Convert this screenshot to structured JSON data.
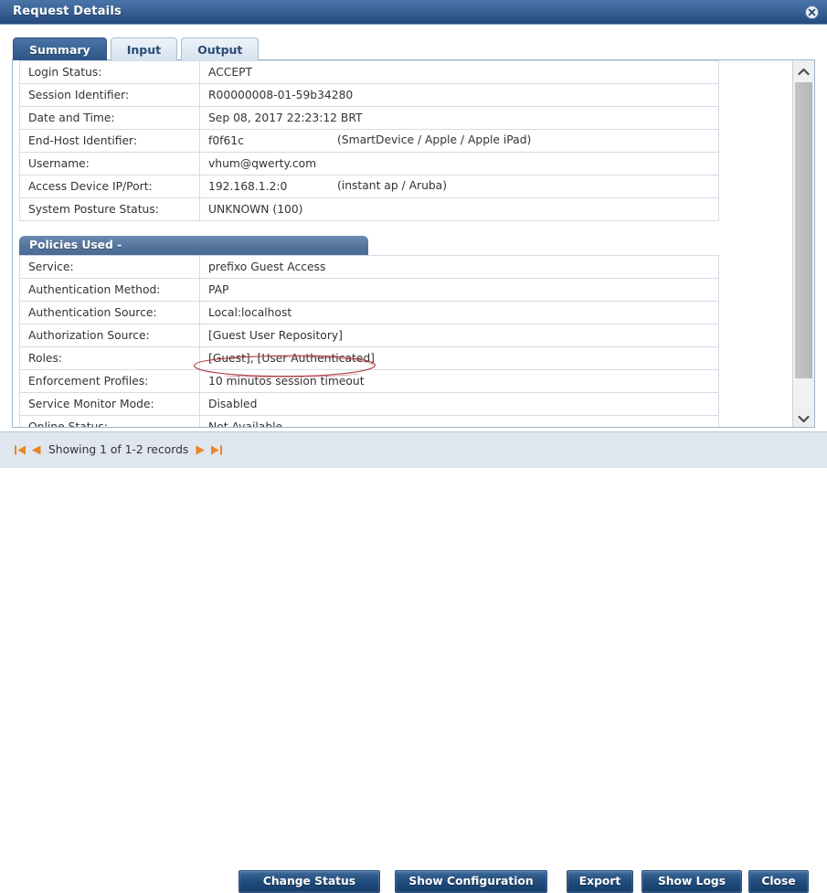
{
  "window": {
    "title": "Request Details",
    "close_icon": "close-circle-icon"
  },
  "tabs": [
    {
      "label": "Summary",
      "active": true
    },
    {
      "label": "Input",
      "active": false
    },
    {
      "label": "Output",
      "active": false
    }
  ],
  "summary": {
    "rows": [
      {
        "key": "Login Status:",
        "value": "ACCEPT",
        "extra": ""
      },
      {
        "key": "Session Identifier:",
        "value": "R00000008-01-59b34280",
        "extra": ""
      },
      {
        "key": "Date and Time:",
        "value": "Sep 08, 2017 22:23:12 BRT",
        "extra": ""
      },
      {
        "key": "End-Host Identifier:",
        "value": "f0f61c",
        "extra": "(SmartDevice / Apple / Apple iPad)"
      },
      {
        "key": "Username:",
        "value": "vhum@qwerty.com",
        "extra": ""
      },
      {
        "key": "Access Device IP/Port:",
        "value": "192.168.1.2:0",
        "extra": "(instant ap / Aruba)"
      },
      {
        "key": "System Posture Status:",
        "value": "UNKNOWN (100)",
        "extra": ""
      }
    ]
  },
  "policies": {
    "header": "Policies Used -",
    "rows": [
      {
        "key": "Service:",
        "value": "prefixo Guest Access"
      },
      {
        "key": "Authentication Method:",
        "value": "PAP"
      },
      {
        "key": "Authentication Source:",
        "value": "Local:localhost"
      },
      {
        "key": "Authorization Source:",
        "value": "[Guest User Repository]"
      },
      {
        "key": "Roles:",
        "value": "[Guest], [User Authenticated]"
      },
      {
        "key": "Enforcement Profiles:",
        "value": "10 minutos session timeout"
      },
      {
        "key": "Service Monitor Mode:",
        "value": "Disabled"
      },
      {
        "key": "Online Status:",
        "value": "Not Available"
      }
    ]
  },
  "annotation": {
    "target_text": "10 minutos session timeout",
    "color": "#a8333c",
    "shape": "ellipse"
  },
  "scrollbar": {
    "up_icon": "chevron-up-icon",
    "down_icon": "chevron-down-icon"
  },
  "footer": {
    "pager": {
      "first_icon": "first-page-icon",
      "prev_icon": "previous-page-icon",
      "text": "Showing 1 of 1-2 records",
      "next_icon": "next-page-icon",
      "last_icon": "last-page-icon",
      "arrow_color": "#e8871e"
    },
    "buttons": [
      {
        "label": "Change Status"
      },
      {
        "label": "Show Configuration"
      },
      {
        "label": "Export"
      },
      {
        "label": "Show Logs"
      },
      {
        "label": "Close"
      }
    ]
  },
  "colors": {
    "titlebar_blue": "#2e5588",
    "tab_active": "#2d5484",
    "section_header": "#54749c",
    "footer_bg": "#dfe6ef",
    "button_blue": "#1e4a7a",
    "annotation_red": "#a8333c",
    "pager_orange": "#e8871e"
  }
}
